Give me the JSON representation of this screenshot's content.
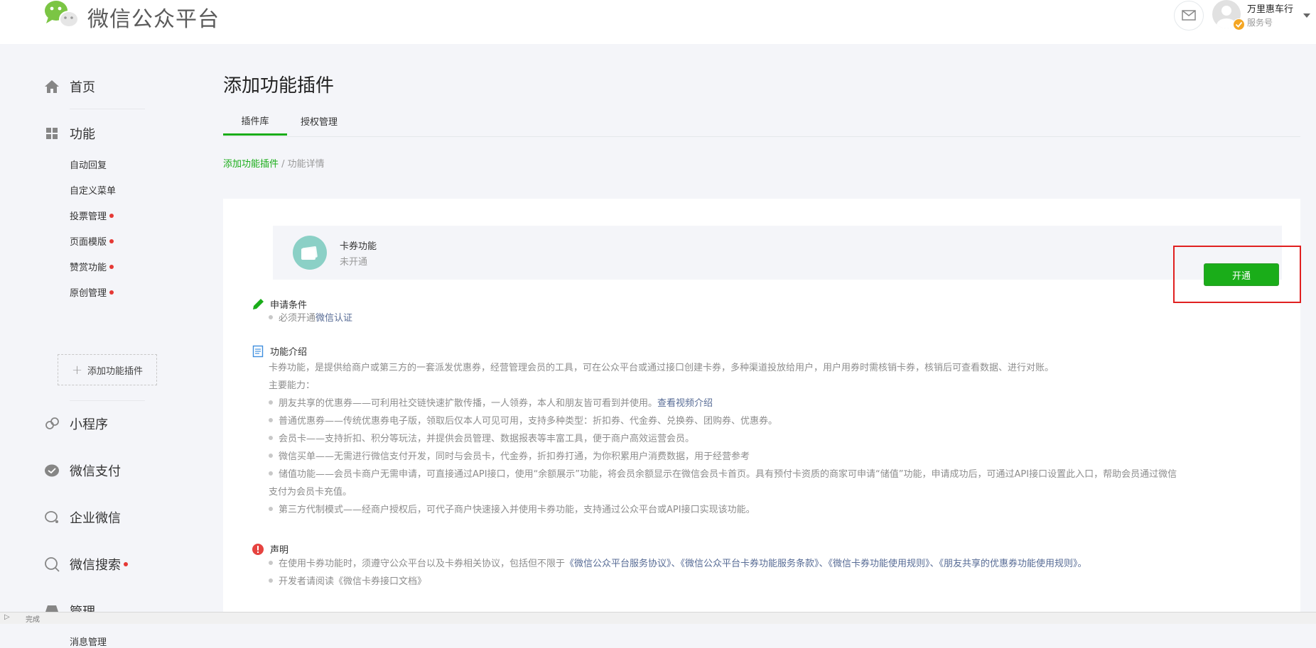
{
  "header": {
    "logo_text": "微信公众平台",
    "account_name": "万里惠车行",
    "account_type": "服务号"
  },
  "sidebar": {
    "home": "首页",
    "functions": "功能",
    "function_items": [
      {
        "label": "自动回复",
        "dot": false
      },
      {
        "label": "自定义菜单",
        "dot": false
      },
      {
        "label": "投票管理",
        "dot": true
      },
      {
        "label": "页面模版",
        "dot": true
      },
      {
        "label": "赞赏功能",
        "dot": true
      },
      {
        "label": "原创管理",
        "dot": true
      }
    ],
    "add_plugin": "添加功能插件",
    "mini_program": "小程序",
    "wechat_pay": "微信支付",
    "enterprise_wechat": "企业微信",
    "wechat_search": "微信搜索",
    "manage": "管理",
    "manage_items": [
      "消息管理"
    ]
  },
  "main": {
    "title": "添加功能插件",
    "tabs": [
      {
        "label": "插件库",
        "active": true
      },
      {
        "label": "授权管理",
        "active": false
      }
    ],
    "breadcrumb": {
      "link": "添加功能插件",
      "separator": " / ",
      "current": "功能详情"
    }
  },
  "feature": {
    "name": "卡券功能",
    "status": "未开通",
    "enable_button": "开通"
  },
  "sections": {
    "conditions": {
      "title": "申请条件",
      "item_prefix": "必须开通",
      "item_link": "微信认证"
    },
    "intro": {
      "title": "功能介绍",
      "description": "卡券功能，是提供给商户或第三方的一套派发优惠券，经营管理会员的工具，可在公众平台或通过接口创建卡券，多种渠道投放给用户，用户用券时需核销卡券，核销后可查看数据、进行对账。",
      "abilities_label": "主要能力：",
      "item1_text": "朋友共享的优惠券——可利用社交链快速扩散传播，一人领券，本人和朋友皆可看到并使用。",
      "item1_link": "查看视频介绍",
      "item2": "普通优惠券——传统优惠券电子版，领取后仅本人可见可用，支持多种类型：折扣券、代金券、兑换券、团购券、优惠券。",
      "item3": "会员卡——支持折扣、积分等玩法，并提供会员管理、数据报表等丰富工具，便于商户高效运营会员。",
      "item4": "微信买单——无需进行微信支付开发，同时与会员卡，代金券，折扣券打通，为你积累用户消费数据，用于经营参考",
      "item5_line1": "储值功能——会员卡商户无需申请，可直接通过API接口，使用“余额展示”功能，将会员余额显示在微信会员卡首页。具有预付卡资质的商家可申请“储值”功能，申请成功后，可通过API接口设置此入口，帮助会员通过微信",
      "item5_line2": "支付为会员卡充值。",
      "item6": "第三方代制模式——经商户授权后，可代子商户快速接入并使用卡券功能，支持通过公众平台或API接口实现该功能。"
    },
    "statement": {
      "title": "声明",
      "item1_prefix": "在使用卡券功能时，须遵守公众平台以及卡券相关协议，包括但不限于",
      "item1_links": "《微信公众平台服务协议》、《微信公众平台卡券功能服务条款》、《微信卡券功能使用规则》、《朋友共享的优惠券功能使用规则》。",
      "item2": "开发者请阅读《微信卡券接口文档》"
    }
  },
  "statusbar": {
    "text": "完成"
  },
  "colors": {
    "brand_green": "#1aad19",
    "link_blue": "#576b95",
    "highlight_red": "#e02020",
    "badge_red": "#e53935"
  }
}
